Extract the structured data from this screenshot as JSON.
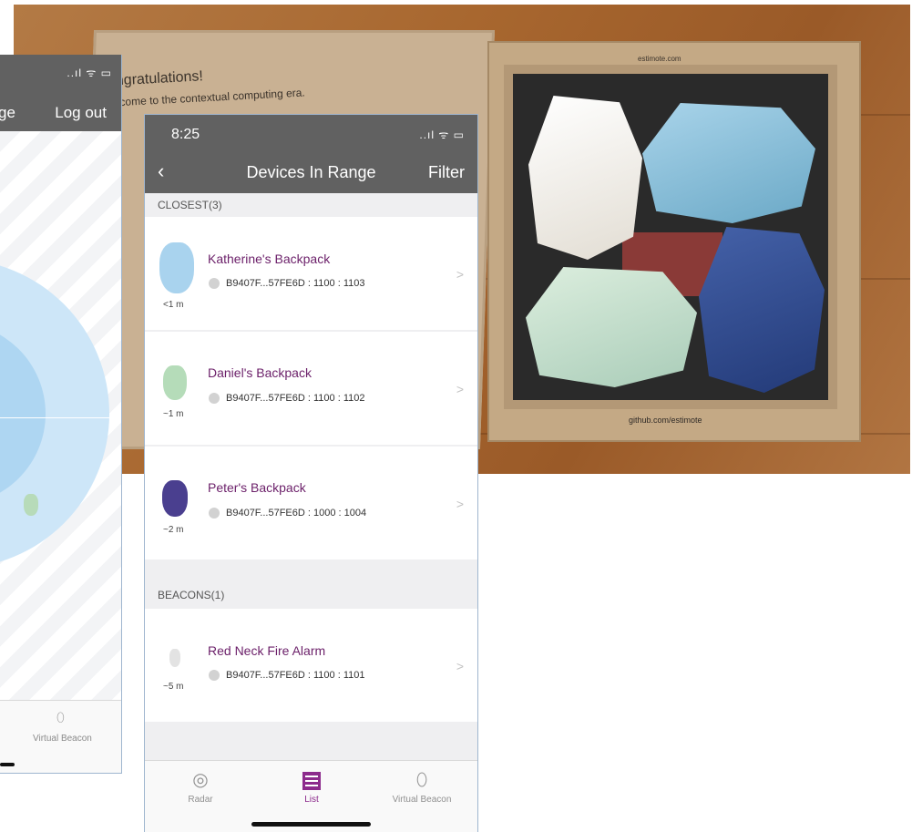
{
  "photo": {
    "lid_heading": "ongratulations!",
    "lid_subheading": "elcome to the contextual computing era.",
    "box_brand_top": "estimote.com",
    "box_brand_bottom": "github.com/estimote"
  },
  "back_screen": {
    "nav_left_fragment": "ge",
    "nav_logout": "Log out",
    "tab_virtual_beacon": "Virtual Beacon"
  },
  "front_screen": {
    "status_time": "8:25",
    "status_icons": "..ıl ᯤ ▭",
    "nav_back": "‹",
    "nav_title": "Devices In Range",
    "nav_filter": "Filter",
    "sections": [
      {
        "header": "CLOSEST(3)",
        "items": [
          {
            "name": "Katherine's Backpack",
            "id": "B9407F...57FE6D : 1100 : 1103",
            "distance": "<1 m",
            "color": "#a9d3ee"
          },
          {
            "name": "Daniel's Backpack",
            "id": "B9407F...57FE6D : 1100 : 1102",
            "distance": "~1 m",
            "color": "#b5dcb9"
          },
          {
            "name": "Peter's Backpack",
            "id": "B9407F...57FE6D : 1000 : 1004",
            "distance": "~2 m",
            "color": "#4a3f8f"
          }
        ]
      },
      {
        "header": "BEACONS(1)",
        "items": [
          {
            "name": "Red Neck Fire Alarm",
            "id": "B9407F...57FE6D : 1100 : 1101",
            "distance": "~5 m",
            "color": "#e3e3e3"
          }
        ]
      }
    ],
    "tabs": [
      {
        "label": "Radar",
        "icon": "radar-icon",
        "active": false
      },
      {
        "label": "List",
        "icon": "list-icon",
        "active": true
      },
      {
        "label": "Virtual Beacon",
        "icon": "beacon-icon",
        "active": false
      }
    ],
    "accent_color": "#8c2a8c",
    "name_color": "#6b1f69",
    "nav_bar_color": "#616161"
  }
}
